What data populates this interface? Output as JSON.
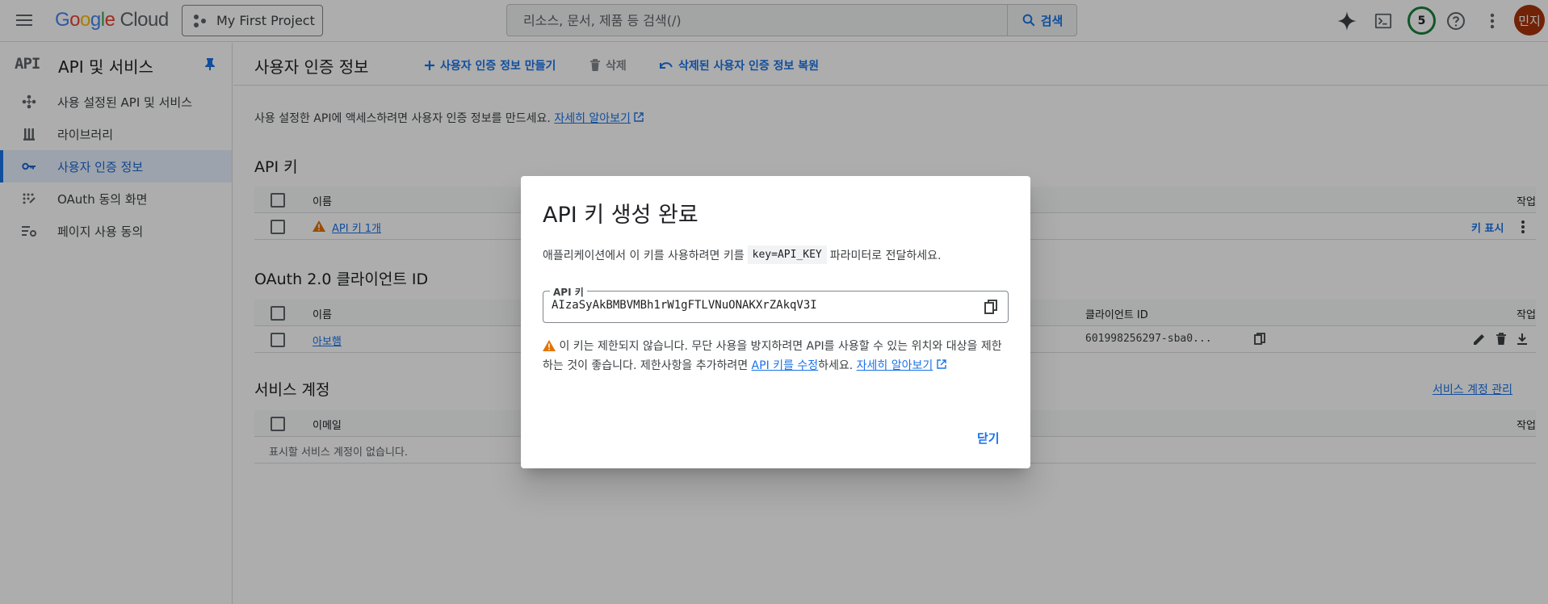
{
  "topbar": {
    "logo_google": [
      "G",
      "o",
      "o",
      "g",
      "l",
      "e"
    ],
    "logo_cloud": "Cloud",
    "project": "My First Project",
    "search_placeholder": "리소스, 문서, 제품 등 검색(/)",
    "search_button": "검색",
    "notification_count": "5",
    "avatar_initials": "민지"
  },
  "sidebar": {
    "badge": "API",
    "title": "API 및 서비스",
    "items": [
      {
        "label": "사용 설정된 API 및 서비스",
        "icon": "diamond-nodes-icon"
      },
      {
        "label": "라이브러리",
        "icon": "library-icon"
      },
      {
        "label": "사용자 인증 정보",
        "icon": "key-icon"
      },
      {
        "label": "OAuth 동의 화면",
        "icon": "oauth-consent-icon"
      },
      {
        "label": "페이지 사용 동의",
        "icon": "settings-list-icon"
      }
    ]
  },
  "main": {
    "title": "사용자 인증 정보",
    "actions": {
      "create": "사용자 인증 정보 만들기",
      "delete": "삭제",
      "restore": "삭제된 사용자 인증 정보 복원"
    },
    "intro": "사용 설정한 API에 액세스하려면 사용자 인증 정보를 만드세요.",
    "learn_more": "자세히 알아보기",
    "api_keys": {
      "title": "API 키",
      "col_name": "이름",
      "col_action": "작업",
      "row_name": "API 키 1개",
      "show_key": "키 표시"
    },
    "oauth": {
      "title": "OAuth 2.0 클라이언트 ID",
      "col_name": "이름",
      "col_client": "클라이언트 ID",
      "col_action": "작업",
      "row_name": "아보햄",
      "row_client": "601998256297-sba0..."
    },
    "service_accounts": {
      "title": "서비스 계정",
      "manage": "서비스 계정 관리",
      "col_email": "이메일",
      "col_action": "작업",
      "empty": "표시할 서비스 계정이 없습니다."
    }
  },
  "dialog": {
    "title": "API 키 생성 완료",
    "text_before": "애플리케이션에서 이 키를 사용하려면 키를",
    "code": "key=API_KEY",
    "text_after": "파라미터로 전달하세요.",
    "field_label": "API 키",
    "api_key": "AIzaSyAkBMBVMBh1rW1gFTLVNuONAKXrZAkqV3I",
    "warn_text": "이 키는 제한되지 않습니다. 무단 사용을 방지하려면 API를 사용할 수 있는 위치와 대상을 제한하는 것이 좋습니다. 제한사항을 추가하려면",
    "warn_link": "API 키를 수정",
    "warn_after": "하세요.",
    "warn_learn": "자세히 알아보기",
    "close": "닫기"
  },
  "colors": {
    "accent": "#1a73e8",
    "warning": "#e37400",
    "avatar": "#a8340b",
    "badge_ring": "#188038"
  }
}
